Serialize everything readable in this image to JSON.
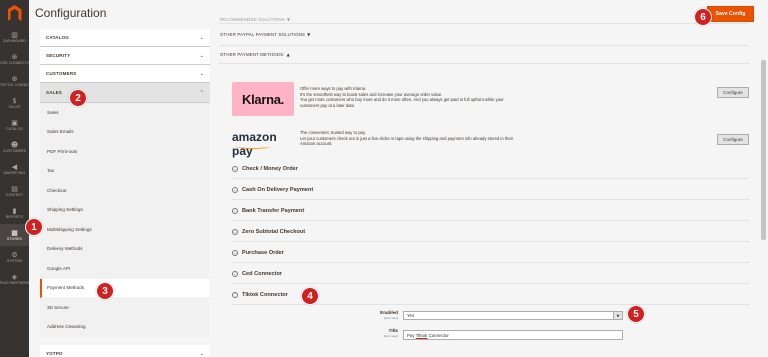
{
  "nav": {
    "items": [
      {
        "label": "DASHBOARD",
        "icon": "dashboard-icon",
        "glyph": "▥"
      },
      {
        "label": "CED CONNECTOR",
        "icon": "ced-connector-icon",
        "glyph": "⊕"
      },
      {
        "label": "TIKTOK CONNECTOR",
        "icon": "tiktok-connector-icon",
        "glyph": "⊕"
      },
      {
        "label": "SALES",
        "icon": "sales-icon",
        "glyph": "$"
      },
      {
        "label": "CATALOG",
        "icon": "catalog-icon",
        "glyph": "▣"
      },
      {
        "label": "CUSTOMERS",
        "icon": "customers-icon",
        "glyph": "☻"
      },
      {
        "label": "MARKETING",
        "icon": "marketing-icon",
        "glyph": "◀"
      },
      {
        "label": "CONTENT",
        "icon": "content-icon",
        "glyph": "▤"
      },
      {
        "label": "REPORTS",
        "icon": "reports-icon",
        "glyph": "▮"
      },
      {
        "label": "STORES",
        "icon": "stores-icon",
        "glyph": "▦",
        "active": true
      },
      {
        "label": "SYSTEM",
        "icon": "system-icon",
        "glyph": "⚙"
      },
      {
        "label": "FIND PARTNERS & EXTENSIONS",
        "icon": "extensions-icon",
        "glyph": "◈"
      }
    ]
  },
  "header": {
    "title": "Configuration",
    "save_label": "Save Config"
  },
  "sidebar": {
    "groups": [
      {
        "label": "CATALOG"
      },
      {
        "label": "SECURITY"
      },
      {
        "label": "CUSTOMERS"
      }
    ],
    "open_group": "SALES",
    "items": [
      "Sales",
      "Sales Emails",
      "PDF Print-outs",
      "Tax",
      "Checkout",
      "Shipping Settings",
      "Multishipping Settings",
      "Delivery Methods",
      "Google API",
      "Payment Methods",
      "3D Secure",
      "Address Cleansing"
    ],
    "active_item": "Payment Methods",
    "bottom_group": "YOTPO"
  },
  "main": {
    "groups": [
      {
        "label": "RECOMMENDED SOLUTIONS",
        "arrow": "▼"
      },
      {
        "label": "OTHER PAYPAL PAYMENT SOLUTIONS",
        "arrow": "▼"
      },
      {
        "label": "OTHER PAYMENT METHODS:",
        "arrow": "▲"
      }
    ],
    "klarna": {
      "logo_text": "Klarna.",
      "lines": [
        "Offer more ways to pay with Klarna.",
        "It's the smoothest way to boost sales and increase your average order value.",
        "You get more customers who buy more and do it more often. And you always get paid in full upfront while your",
        "customers pay at a later date."
      ],
      "button": "Configure"
    },
    "amazon": {
      "logo_text": "amazon pay",
      "lines": [
        "The convenient, trusted way to pay.",
        "Let your customers check out in just a few clicks or taps using the shipping and payment info already stored in their",
        "Amazon account."
      ],
      "button": "Configure"
    },
    "sections": [
      "Check / Money Order",
      "Cash On Delivery Payment",
      "Bank Transfer Payment",
      "Zero Subtotal Checkout",
      "Purchase Order",
      "Ced Connector",
      "Tiktok Connector"
    ],
    "form": {
      "enabled_label": "Enabled",
      "enabled_scope": "[store view]",
      "enabled_value": "Yes",
      "title_label": "Title",
      "title_scope": "[store view]",
      "title_value_prefix": "Pay ",
      "title_value_word": "Tiktok",
      "title_value_suffix": " Connector"
    }
  },
  "badges": [
    "1",
    "2",
    "3",
    "4",
    "5",
    "6"
  ],
  "colors": {
    "accent": "#eb5202",
    "badge": "#d21f1f",
    "nav_bg": "#373330",
    "klarna_pink": "#ffb3c7"
  }
}
